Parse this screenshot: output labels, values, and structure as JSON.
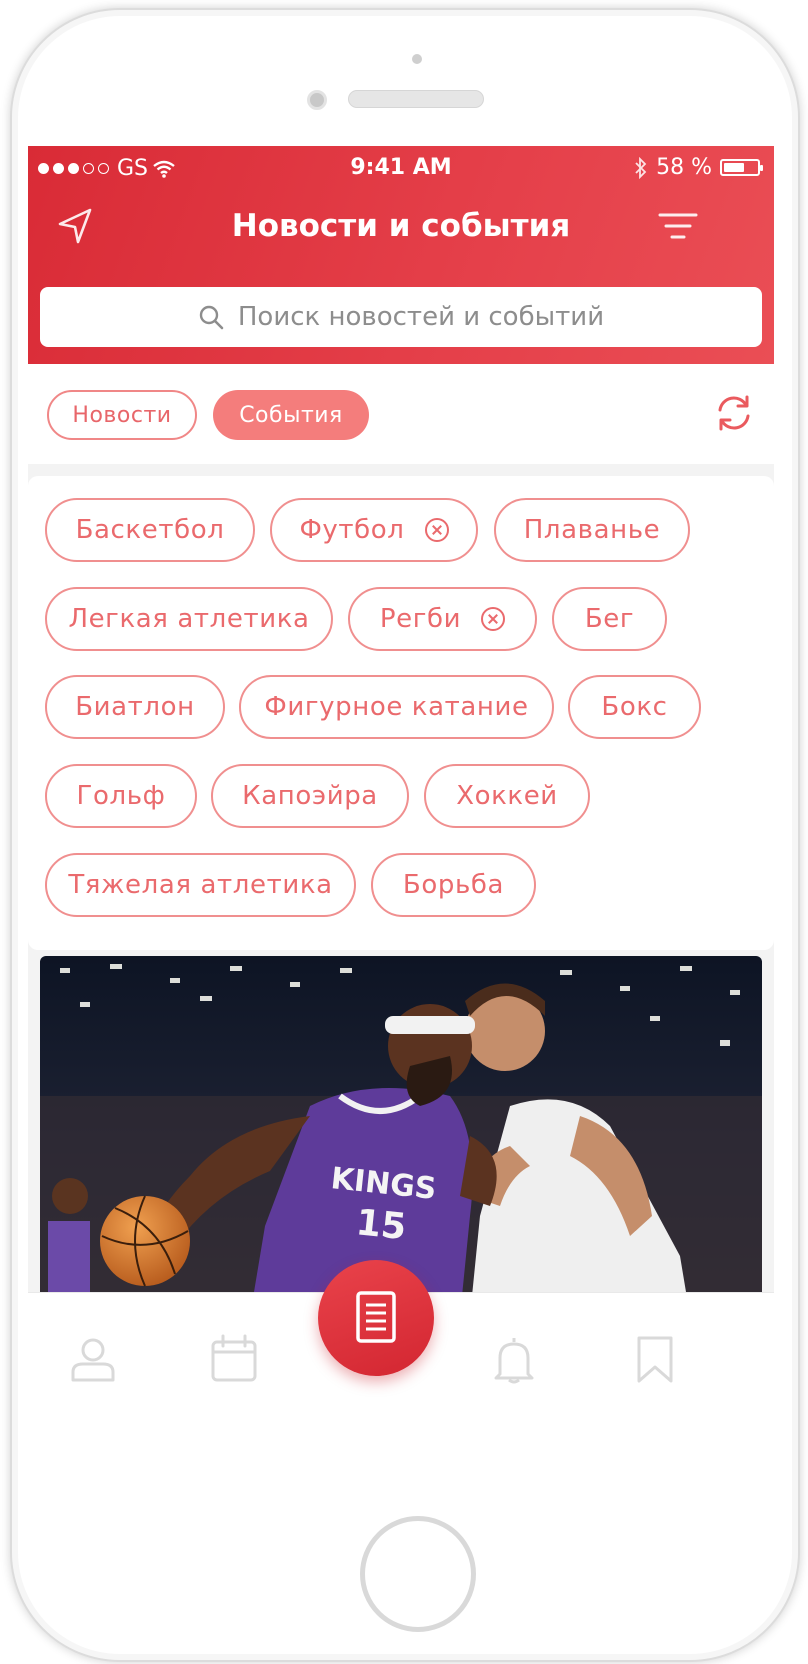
{
  "status_bar": {
    "carrier": "GS",
    "time": "9:41 AM",
    "battery": "58 %"
  },
  "header": {
    "title": "Новости и события",
    "search_placeholder": "Поиск новостей и событий"
  },
  "tabs": {
    "news": "Новости",
    "events": "События",
    "active": "events"
  },
  "categories": [
    {
      "label": "Баскетбол",
      "removable": false
    },
    {
      "label": "Футбол",
      "removable": true
    },
    {
      "label": "Плаванье",
      "removable": false
    },
    {
      "label": "Легкая атлетика",
      "removable": false
    },
    {
      "label": "Регби",
      "removable": true
    },
    {
      "label": "Бег",
      "removable": false
    },
    {
      "label": "Биатлон",
      "removable": false
    },
    {
      "label": "Фигурное катание",
      "removable": false
    },
    {
      "label": "Бокс",
      "removable": false
    },
    {
      "label": "Гольф",
      "removable": false
    },
    {
      "label": "Капоэйра",
      "removable": false
    },
    {
      "label": "Хоккей",
      "removable": false
    },
    {
      "label": "Тяжелая атлетика",
      "removable": false
    },
    {
      "label": "Борьба",
      "removable": false
    }
  ],
  "news_card": {
    "jersey_text": "KINGS",
    "jersey_number": "15"
  },
  "tab_bar": [
    "profile-icon",
    "calendar-icon",
    "news-icon",
    "bell-icon",
    "bookmark-icon"
  ],
  "colors": {
    "accent": "#e5404a",
    "chip_border": "#f08f8f",
    "chip_text": "#ea6a6d",
    "active_tab": "#f47d7c"
  }
}
